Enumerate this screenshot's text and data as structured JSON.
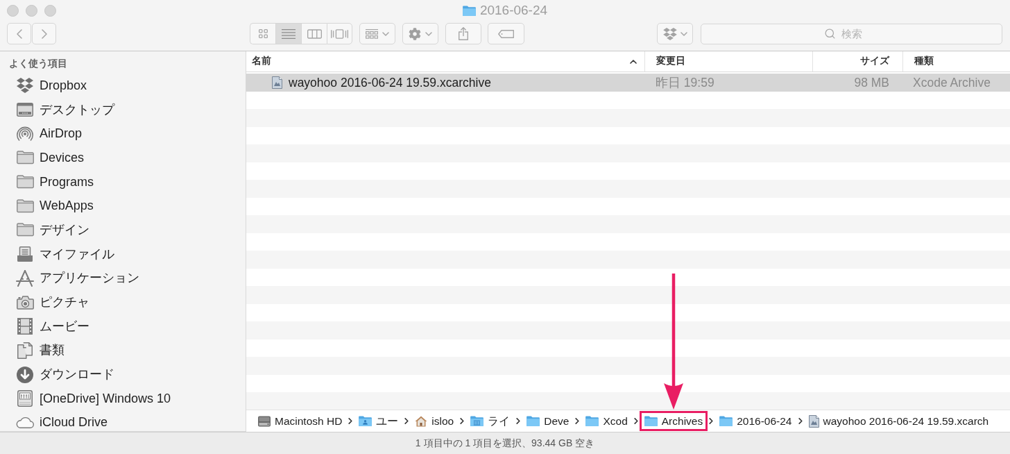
{
  "window": {
    "title": "2016-06-24"
  },
  "toolbar": {
    "view_modes": [
      {
        "kind": "icon",
        "selected": false
      },
      {
        "kind": "list",
        "selected": true
      },
      {
        "kind": "column",
        "selected": false
      },
      {
        "kind": "coverflow",
        "selected": false
      }
    ],
    "search": {
      "placeholder": "検索"
    }
  },
  "sidebar": {
    "heading": "よく使う項目",
    "items": [
      {
        "label": "Dropbox",
        "kind": "dropbox",
        "selected": false
      },
      {
        "label": "デスクトップ",
        "kind": "desktop",
        "selected": false
      },
      {
        "label": "AirDrop",
        "kind": "airdrop",
        "selected": false
      },
      {
        "label": "Devices",
        "kind": "folder",
        "selected": false
      },
      {
        "label": "Programs",
        "kind": "folder",
        "selected": false
      },
      {
        "label": "WebApps",
        "kind": "folder",
        "selected": false
      },
      {
        "label": "デザイン",
        "kind": "folder",
        "selected": false
      },
      {
        "label": "マイファイル",
        "kind": "myfiles",
        "selected": false
      },
      {
        "label": "アプリケーション",
        "kind": "applications",
        "selected": false
      },
      {
        "label": "ピクチャ",
        "kind": "pictures",
        "selected": false
      },
      {
        "label": "ムービー",
        "kind": "movies",
        "selected": false
      },
      {
        "label": "書類",
        "kind": "documents",
        "selected": false
      },
      {
        "label": "ダウンロード",
        "kind": "downloads",
        "selected": false
      },
      {
        "label": "[OneDrive] Windows 10",
        "kind": "drive",
        "selected": false
      },
      {
        "label": "iCloud Drive",
        "kind": "icloud",
        "selected": false
      }
    ]
  },
  "table": {
    "columns": [
      {
        "label": "名前",
        "sorted": true
      },
      {
        "label": "変更日",
        "sorted": false
      },
      {
        "label": "サイズ",
        "sorted": false
      },
      {
        "label": "種類",
        "sorted": false
      }
    ],
    "rows": [
      {
        "selected": true,
        "cells": [
          "wayohoo 2016-06-24 19.59.xcarchive",
          "昨日 19:59",
          "98 MB",
          "Xcode Archive"
        ]
      }
    ]
  },
  "path_bar": {
    "items": [
      {
        "label": "Macintosh HD",
        "kind": "disk",
        "highlighted": false
      },
      {
        "label": "ユー",
        "kind": "user-folder",
        "highlighted": false
      },
      {
        "label": "isloo",
        "kind": "home",
        "highlighted": false
      },
      {
        "label": "ライ",
        "kind": "library-folder",
        "highlighted": false
      },
      {
        "label": "Deve",
        "kind": "folder",
        "highlighted": false
      },
      {
        "label": "Xcod",
        "kind": "folder",
        "highlighted": false
      },
      {
        "label": "Archives",
        "kind": "folder",
        "highlighted": true
      },
      {
        "label": "2016-06-24",
        "kind": "folder",
        "highlighted": false
      },
      {
        "label": "wayohoo 2016-06-24 19.59.xcarch",
        "kind": "archive-file",
        "highlighted": false
      }
    ]
  },
  "status_bar": {
    "text": "1 項目中の 1 項目を選択、93.44 GB 空き"
  }
}
